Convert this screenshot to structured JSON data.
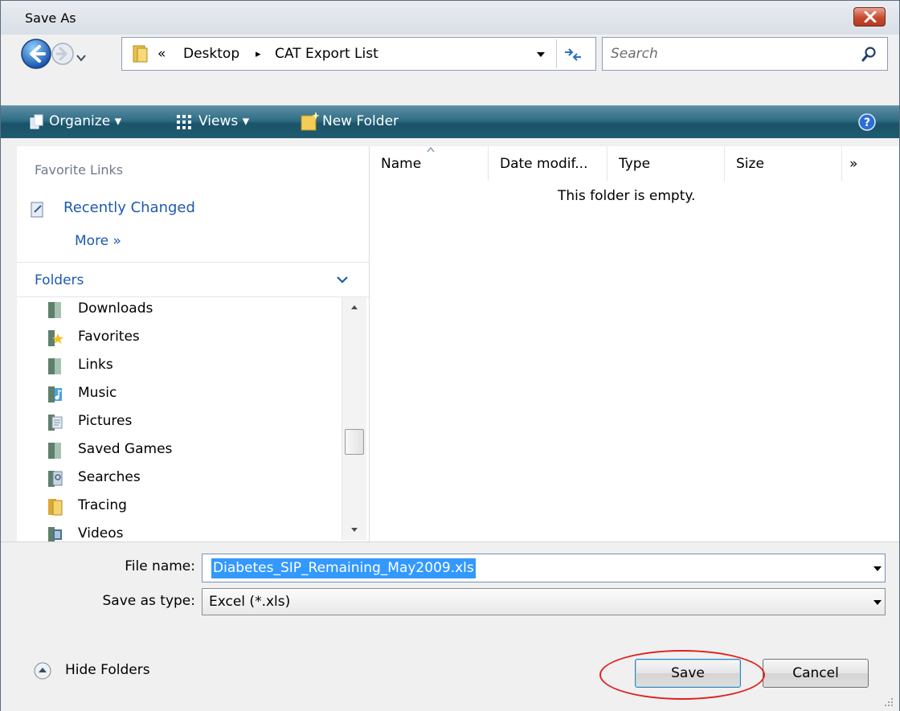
{
  "window": {
    "title": "Save As"
  },
  "address": {
    "crumbs": [
      "«",
      "Desktop",
      "▸",
      "CAT Export List"
    ]
  },
  "search": {
    "placeholder": "Search"
  },
  "toolbar": {
    "organize": "Organize ▾",
    "views": "Views ▾",
    "new_folder": "New Folder"
  },
  "favorites": {
    "title": "Favorite Links",
    "items": [
      "Recently Changed"
    ],
    "more": "More  »"
  },
  "folders": {
    "title": "Folders",
    "items": [
      "Downloads",
      "Favorites",
      "Links",
      "Music",
      "Pictures",
      "Saved Games",
      "Searches",
      "Tracing",
      "Videos"
    ]
  },
  "columns": [
    "Name",
    "Date modif...",
    "Type",
    "Size"
  ],
  "columns_more": "»",
  "empty_message": "This folder is empty.",
  "form": {
    "filename_label": "File name:",
    "filename_value": "Diabetes_SIP_Remaining_May2009.xls",
    "type_label": "Save as type:",
    "type_value": "Excel (*.xls)"
  },
  "hide_folders": "Hide Folders",
  "buttons": {
    "save": "Save",
    "cancel": "Cancel"
  },
  "colors": {
    "toolbar": "#1f5b70",
    "link": "#1d5aaf",
    "selection": "#3399ff",
    "annotation": "#e02020"
  }
}
